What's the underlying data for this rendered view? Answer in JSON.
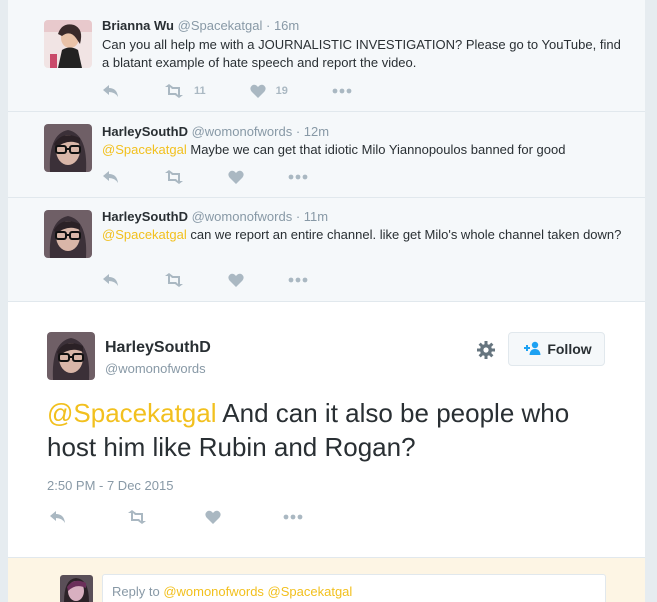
{
  "tweets": [
    {
      "name": "Brianna Wu",
      "handle": "@Spacekatgal",
      "time": "· 16m",
      "text": "Can you all help me with a JOURNALISTIC INVESTIGATION? Please go to YouTube, find a blatant example of hate speech and report the video.",
      "retweet_count": "11",
      "like_count": "19"
    },
    {
      "name": "HarleySouthD",
      "handle": "@womonofwords",
      "time": "· 12m",
      "mention": "@Spacekatgal",
      "text": " Maybe we can get that idiotic Milo Yiannopoulos banned for good"
    },
    {
      "name": "HarleySouthD",
      "handle": "@womonofwords",
      "time": "· 11m",
      "mention": "@Spacekatgal",
      "text": " can we report an entire channel. like get Milo's whole channel taken down?"
    }
  ],
  "main_tweet": {
    "name": "HarleySouthD",
    "handle": "@womonofwords",
    "follow_label": "Follow",
    "mention": "@Spacekatgal",
    "text": " And can it also be people who host him like Rubin and Rogan?",
    "timestamp": "2:50 PM - 7 Dec 2015"
  },
  "reply": {
    "prefix": "Reply to ",
    "mentions": "@womonofwords @Spacekatgal"
  },
  "colors": {
    "mention": "#f2c01e",
    "action_icon": "#aab8c2",
    "context_bg": "#f5f8fa",
    "reply_bg": "#fdf5e4"
  },
  "icons": [
    "reply-icon",
    "retweet-icon",
    "like-icon",
    "more-icon",
    "gear-icon",
    "follow-person-icon"
  ]
}
